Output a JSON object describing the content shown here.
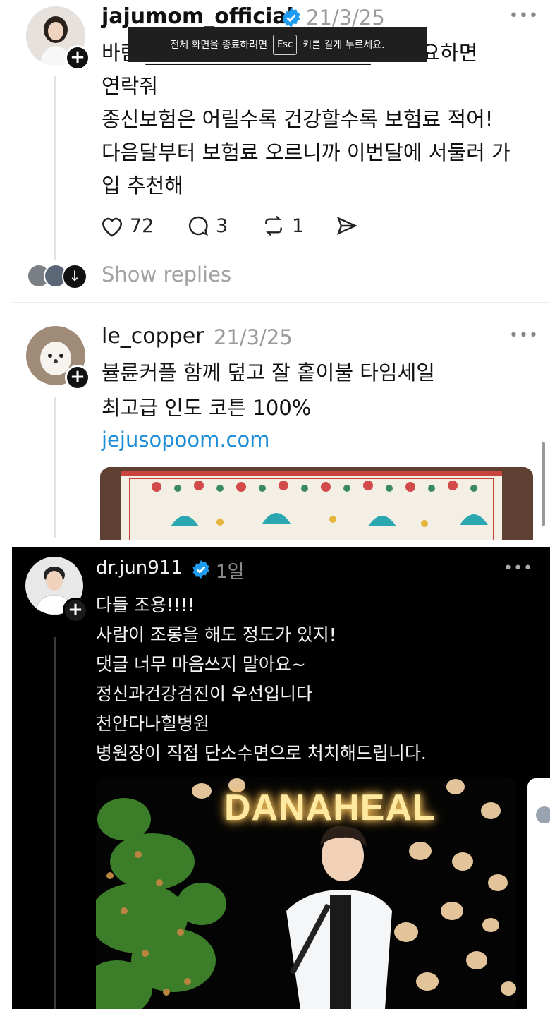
{
  "toast": {
    "before": "전체 화면을 종료하려면",
    "key": "Esc",
    "after": "키를 길게 누르세요."
  },
  "post1": {
    "username": "jajumom_official",
    "timestamp": "21/3/25",
    "body": "바람 ______________________ 험 필요하면\n연락줘\n종신보험은 어릴수록 건강할수록 보험료 적어!\n다음달부터 보험료 오르니까 이번달에 서둘러 가\n입 추천해",
    "likes": "72",
    "comments": "3",
    "reposts": "1",
    "show_replies": "Show replies"
  },
  "post2": {
    "username": "le_copper",
    "timestamp": "21/3/25",
    "body": "뷸륜커플 함께 덮고 잘 홑이불 타임세일\n최고급 인도 코튼 100%",
    "link": "jejusopoom.com"
  },
  "post3": {
    "username": "dr.jun911",
    "timestamp": "1일",
    "body": "다들 조용!!!!\n사람이 조롱을 해도 정도가 있지!\n댓글 너무 마음쓰지 말아요~\n정신과건강검진이 우선입니다\n천안다나힐병원\n병원장이 직접 단소수면으로 처치해드립니다.",
    "image_title": "DANAHEAL"
  },
  "colors": {
    "verified": "#1d9bf0",
    "link": "#1a8cd8",
    "dark_bg": "#000000",
    "glow": "#ffe9a0"
  },
  "icons": [
    "heart-icon",
    "comment-icon",
    "repost-icon",
    "share-icon",
    "verified-icon",
    "plus-icon",
    "more-icon",
    "arrow-down-icon"
  ]
}
